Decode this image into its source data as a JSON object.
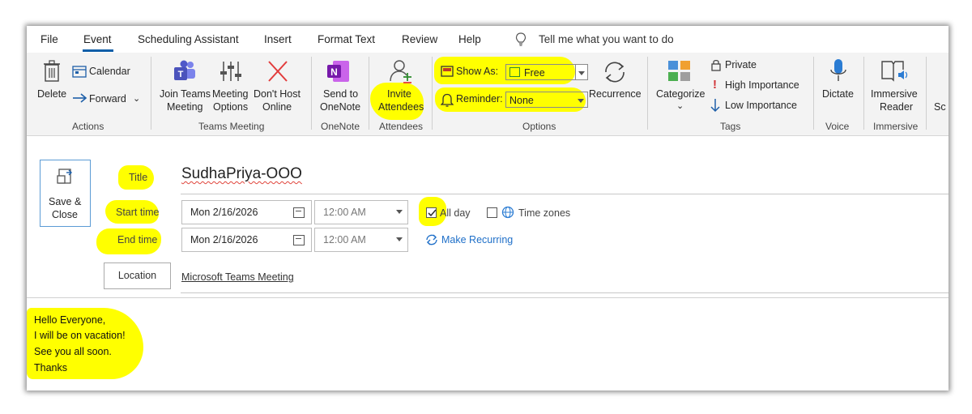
{
  "menu": {
    "file": "File",
    "event": "Event",
    "scheduling": "Scheduling Assistant",
    "insert": "Insert",
    "format_text": "Format Text",
    "review": "Review",
    "help": "Help",
    "tell_me": "Tell me what you want to do"
  },
  "ribbon": {
    "actions": {
      "delete": "Delete",
      "calendar": "Calendar",
      "forward": "Forward",
      "label": "Actions"
    },
    "teams": {
      "join_1": "Join Teams",
      "join_2": "Meeting",
      "options_1": "Meeting",
      "options_2": "Options",
      "donthost_1": "Don't Host",
      "donthost_2": "Online",
      "label": "Teams Meeting"
    },
    "onenote": {
      "send_1": "Send to",
      "send_2": "OneNote",
      "label": "OneNote"
    },
    "attendees": {
      "invite_1": "Invite",
      "invite_2": "Attendees",
      "label": "Attendees"
    },
    "options": {
      "show_as": "Show As:",
      "show_as_value": "Free",
      "reminder": "Reminder:",
      "reminder_value": "None",
      "recurrence": "Recurrence",
      "label": "Options"
    },
    "tags": {
      "categorize": "Categorize",
      "private": "Private",
      "high": "High Importance",
      "low": "Low Importance",
      "label": "Tags"
    },
    "voice": {
      "dictate": "Dictate",
      "label": "Voice"
    },
    "immersive": {
      "reader_1": "Immersive",
      "reader_2": "Reader",
      "label": "Immersive"
    },
    "cut_off": "Sc"
  },
  "form": {
    "save_1": "Save &",
    "save_2": "Close",
    "title_label": "Title",
    "title_value": "SudhaPriya-OOO",
    "start_label": "Start time",
    "start_date": "Mon 2/16/2026",
    "start_time": "12:00 AM",
    "end_label": "End time",
    "end_date": "Mon 2/16/2026",
    "end_time": "12:00 AM",
    "all_day": "All day",
    "time_zones": "Time zones",
    "make_recurring": "Make Recurring",
    "location_btn": "Location",
    "location_value": "Microsoft Teams Meeting"
  },
  "body": {
    "lines": [
      "Hello Everyone,",
      "I will be on vacation!",
      "See you all soon.",
      "Thanks"
    ]
  },
  "colors": {
    "accent": "#0f5ea8",
    "highlight": "#ffff00"
  }
}
